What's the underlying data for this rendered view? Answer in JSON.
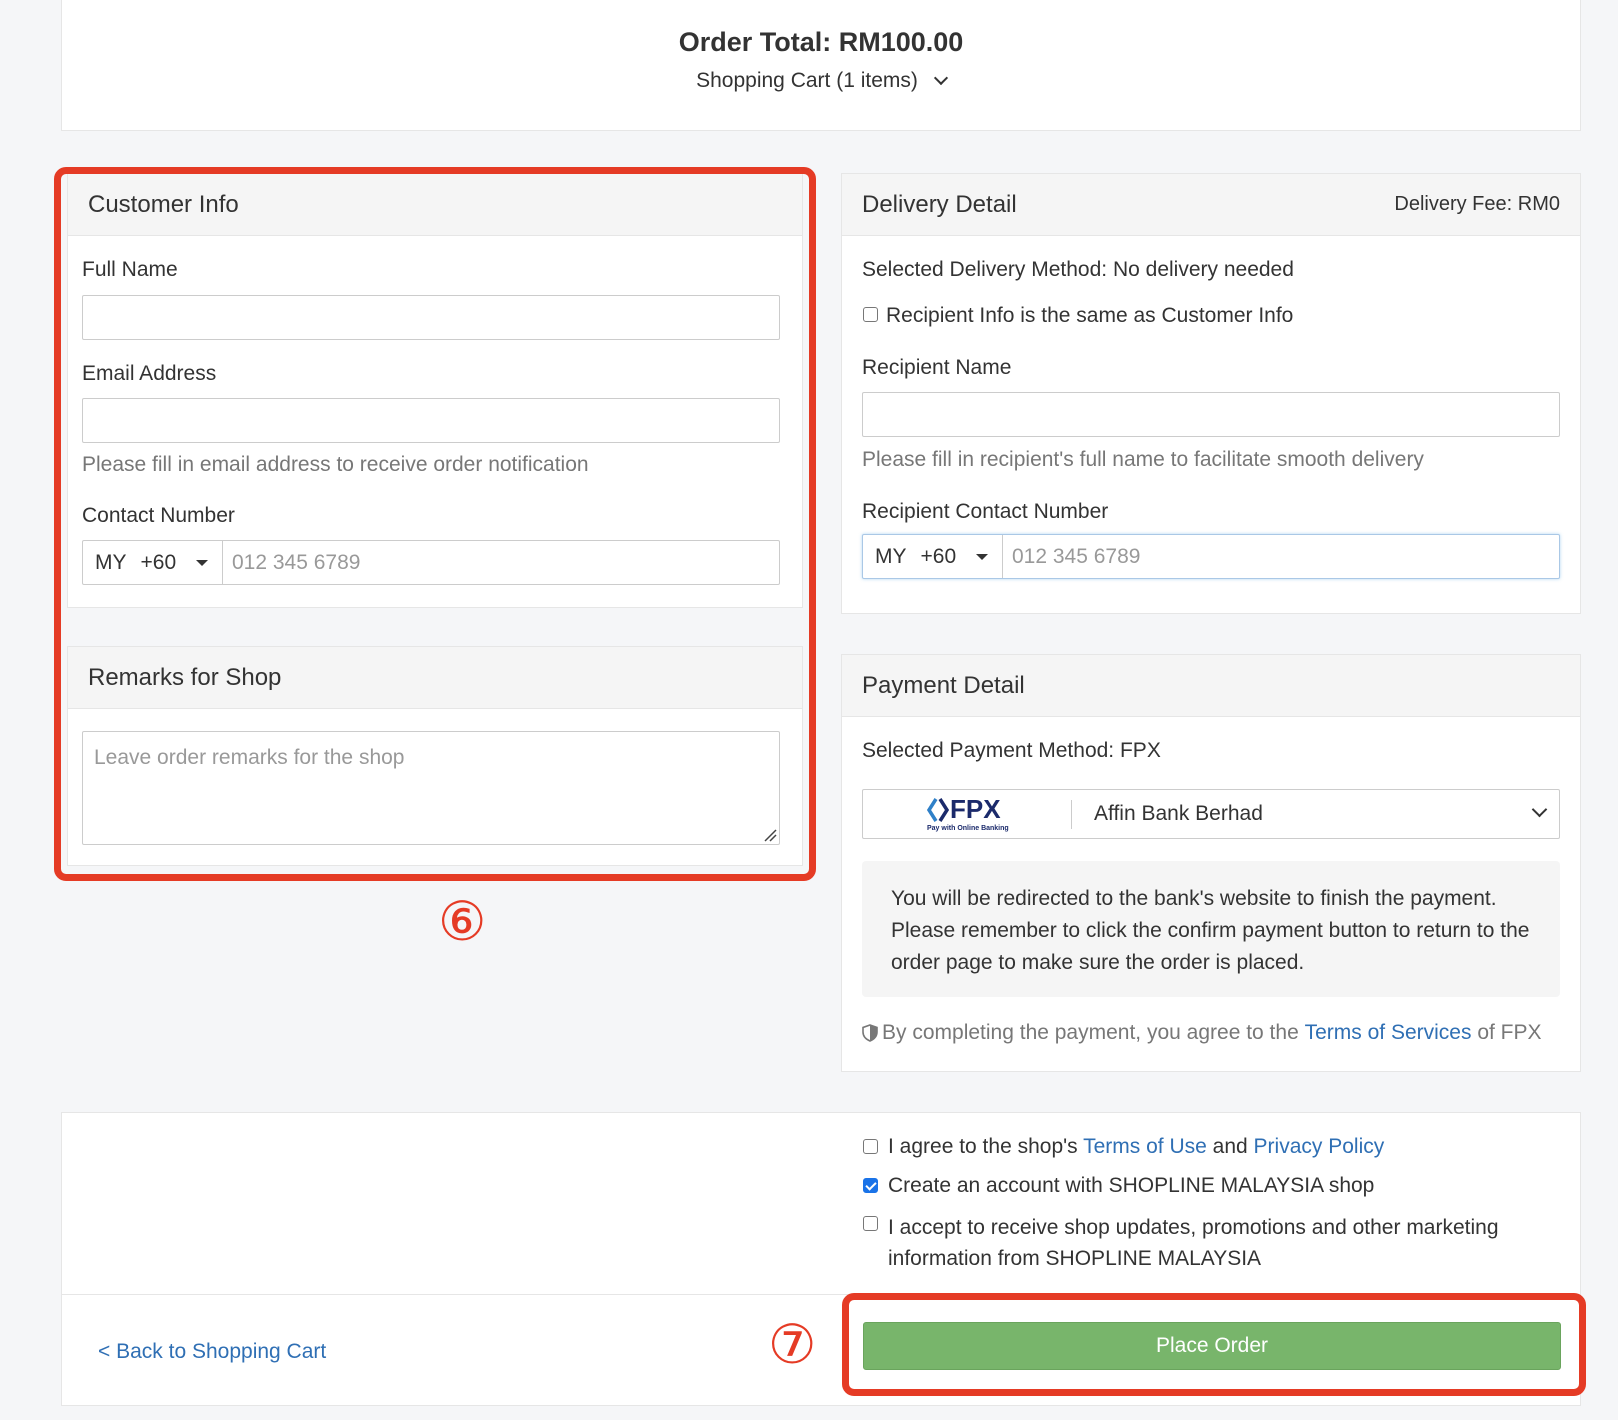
{
  "order": {
    "total_label": "Order Total: RM100.00",
    "cart_label": "Shopping Cart (1 items)",
    "cart_toggle_icon": "chevron-down-icon"
  },
  "customer_info": {
    "title": "Customer Info",
    "full_name_label": "Full Name",
    "full_name_value": "",
    "email_label": "Email Address",
    "email_value": "",
    "email_help": "Please fill in email address to receive order notification",
    "contact_label": "Contact Number",
    "country_code": "MY",
    "dial_code": "+60",
    "phone_placeholder": "012 345 6789"
  },
  "remarks": {
    "title": "Remarks for Shop",
    "placeholder": "Leave order remarks for the shop"
  },
  "delivery": {
    "title": "Delivery Detail",
    "fee_label": "Delivery Fee: RM0",
    "method_label": "Selected Delivery Method: No delivery needed",
    "same_as_customer_label": "Recipient Info is the same as Customer Info",
    "same_as_customer_checked": false,
    "recipient_name_label": "Recipient Name",
    "recipient_name_value": "",
    "recipient_name_help": "Please fill in recipient's full name to facilitate smooth delivery",
    "recipient_contact_label": "Recipient Contact Number",
    "country_code": "MY",
    "dial_code": "+60",
    "phone_placeholder": "012 345 6789"
  },
  "payment": {
    "title": "Payment Detail",
    "method_label": "Selected Payment Method: FPX",
    "fpx_logo_text": "FPX",
    "fpx_logo_subtext": "Pay with Online Banking",
    "bank_selected": "Affin Bank Berhad",
    "redirect_notice": "You will be redirected to the bank's website to finish the payment. Please remember to click the confirm payment button to return to the order page to make sure the order is placed.",
    "agree_prefix": "By completing the payment, you agree to the",
    "agree_link": "Terms of Services",
    "agree_suffix": "of FPX"
  },
  "consents": {
    "terms_prefix": "I agree to the shop's",
    "terms_link": "Terms of Use",
    "terms_and": "and",
    "privacy_link": "Privacy Policy",
    "terms_checked": false,
    "create_account_label": "Create an account with SHOPLINE MALAYSIA shop",
    "create_account_checked": true,
    "marketing_label": "I accept to receive shop updates, promotions and other marketing information from SHOPLINE MALAYSIA",
    "marketing_checked": false
  },
  "actions": {
    "back_link": "< Back to Shopping Cart",
    "place_order": "Place Order"
  },
  "annotations": {
    "step6": "⑥",
    "step7": "⑦"
  },
  "colors": {
    "annotation_red": "#e53b25",
    "place_order_green": "#78b56b",
    "link_blue": "#2f6fb4",
    "fpx_navy": "#1b2a6b"
  }
}
